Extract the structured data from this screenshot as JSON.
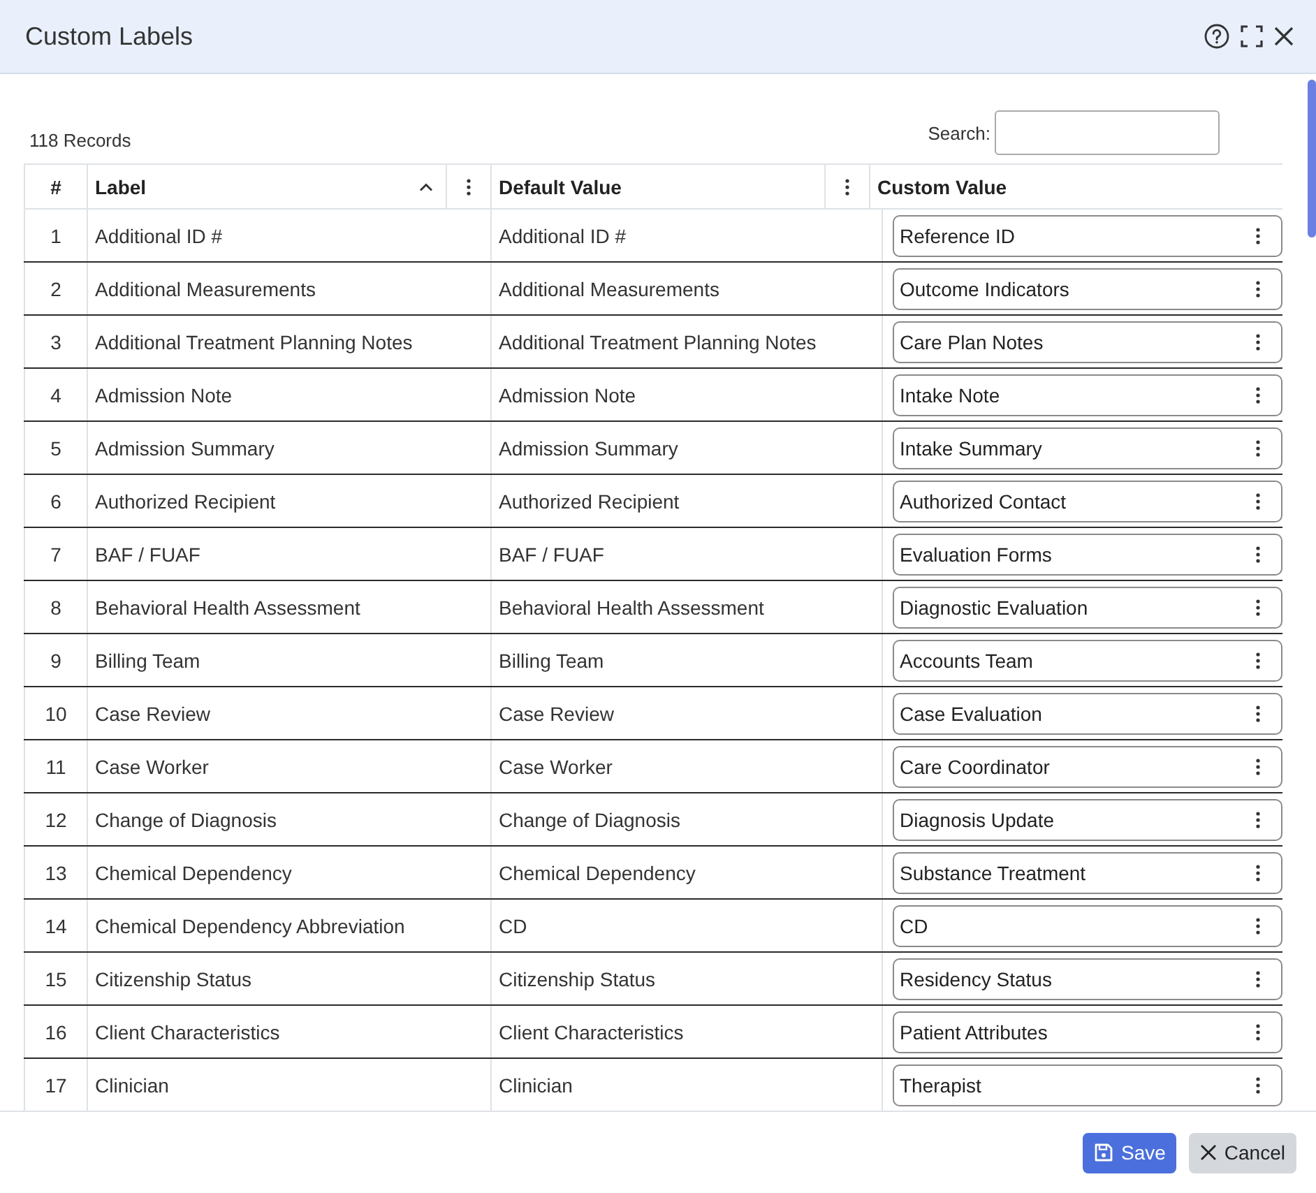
{
  "dialog": {
    "title": "Custom Labels"
  },
  "toolbar": {
    "record_count": "118 Records",
    "search": {
      "label": "Search:"
    }
  },
  "table": {
    "columns": [
      {
        "label": "#",
        "sorted": false,
        "menu": false
      },
      {
        "label": "Label",
        "sorted": true,
        "menu": true
      },
      {
        "label": "Default Value",
        "sorted": false,
        "menu": true
      },
      {
        "label": "Custom Value",
        "sorted": false,
        "menu": false
      }
    ],
    "rows": [
      {
        "number": "1",
        "label": "Additional ID #",
        "default_value": "Additional ID #",
        "custom_value": "Reference ID"
      },
      {
        "number": "2",
        "label": "Additional Measurements",
        "default_value": "Additional Measurements",
        "custom_value": "Outcome Indicators"
      },
      {
        "number": "3",
        "label": "Additional Treatment Planning Notes",
        "default_value": "Additional Treatment Planning Notes",
        "custom_value": "Care Plan Notes"
      },
      {
        "number": "4",
        "label": "Admission Note",
        "default_value": "Admission Note",
        "custom_value": "Intake Note"
      },
      {
        "number": "5",
        "label": "Admission Summary",
        "default_value": "Admission Summary",
        "custom_value": "Intake Summary"
      },
      {
        "number": "6",
        "label": "Authorized Recipient",
        "default_value": "Authorized Recipient",
        "custom_value": "Authorized Contact"
      },
      {
        "number": "7",
        "label": "BAF / FUAF",
        "default_value": "BAF / FUAF",
        "custom_value": "Evaluation Forms"
      },
      {
        "number": "8",
        "label": "Behavioral Health Assessment",
        "default_value": "Behavioral Health Assessment",
        "custom_value": "Diagnostic Evaluation"
      },
      {
        "number": "9",
        "label": "Billing Team",
        "default_value": "Billing Team",
        "custom_value": "Accounts Team"
      },
      {
        "number": "10",
        "label": "Case Review",
        "default_value": "Case Review",
        "custom_value": "Case Evaluation"
      },
      {
        "number": "11",
        "label": "Case Worker",
        "default_value": "Case Worker",
        "custom_value": "Care Coordinator"
      },
      {
        "number": "12",
        "label": "Change of Diagnosis",
        "default_value": "Change of Diagnosis",
        "custom_value": "Diagnosis Update"
      },
      {
        "number": "13",
        "label": "Chemical Dependency",
        "default_value": "Chemical Dependency",
        "custom_value": "Substance Treatment"
      },
      {
        "number": "14",
        "label": "Chemical Dependency Abbreviation",
        "default_value": "CD",
        "custom_value": "CD"
      },
      {
        "number": "15",
        "label": "Citizenship Status",
        "default_value": "Citizenship Status",
        "custom_value": "Residency Status"
      },
      {
        "number": "16",
        "label": "Client Characteristics",
        "default_value": "Client Characteristics",
        "custom_value": "Patient Attributes"
      },
      {
        "number": "17",
        "label": "Clinician",
        "default_value": "Clinician",
        "custom_value": "Therapist"
      }
    ]
  },
  "footer": {
    "buttons": [
      {
        "kind": "primary",
        "label": "Save"
      },
      {
        "kind": "secondary",
        "label": "Cancel"
      }
    ]
  }
}
